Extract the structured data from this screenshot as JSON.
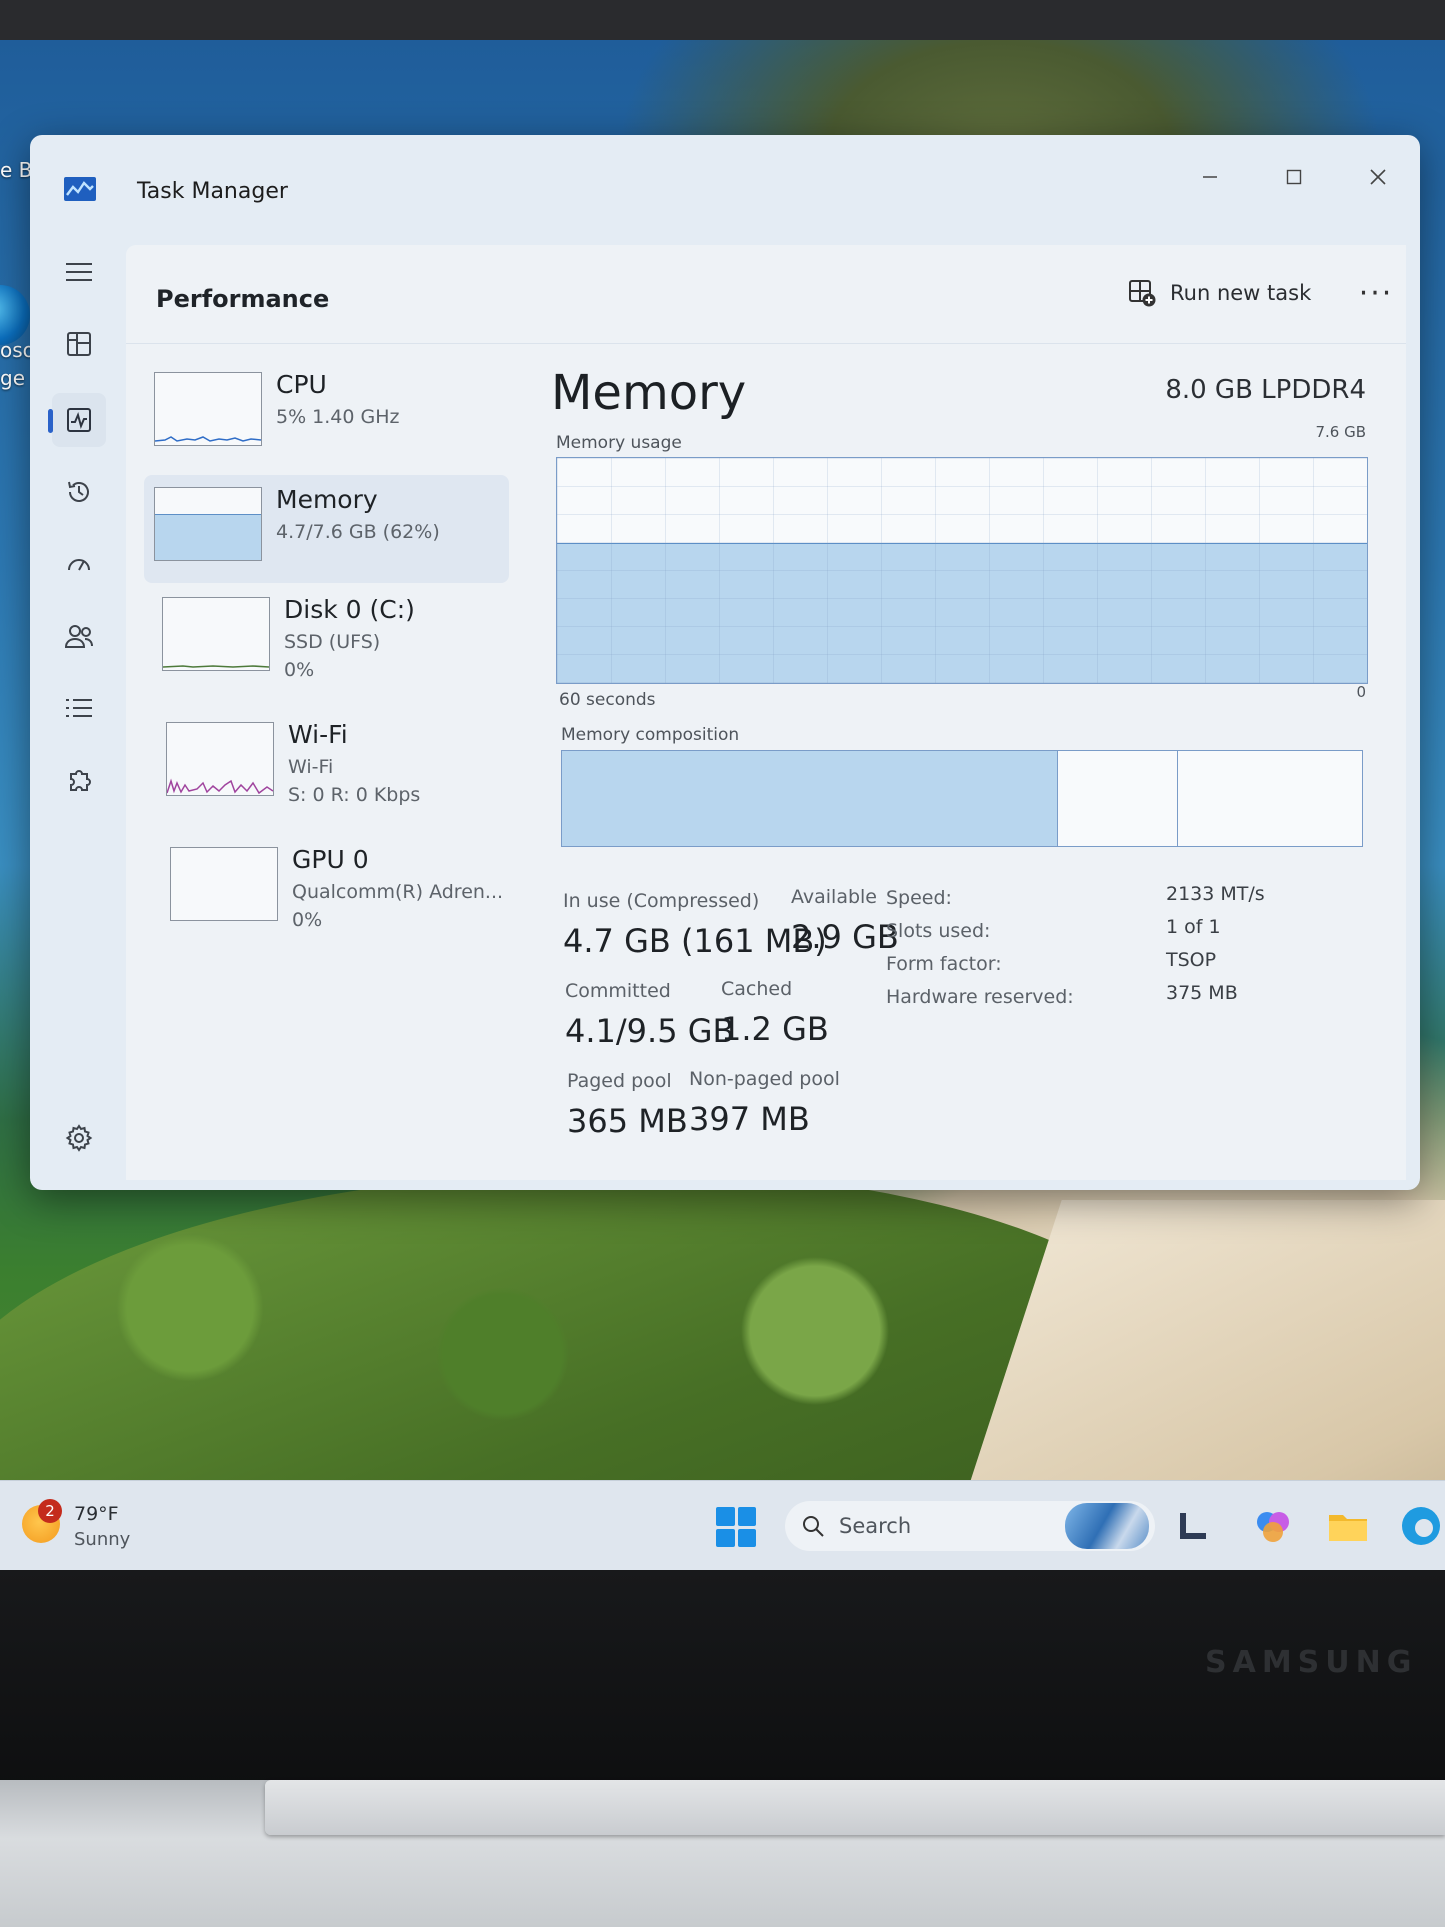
{
  "window": {
    "title": "Task Manager"
  },
  "header": {
    "title": "Performance",
    "run_new_task": "Run new task",
    "more": "···"
  },
  "perf_list": [
    {
      "name": "CPU",
      "sub": "5%  1.40 GHz",
      "sub2": ""
    },
    {
      "name": "Memory",
      "sub": "4.7/7.6 GB (62%)",
      "sub2": ""
    },
    {
      "name": "Disk 0 (C:)",
      "sub": "SSD (UFS)",
      "sub2": "0%"
    },
    {
      "name": "Wi-Fi",
      "sub": "Wi-Fi",
      "sub2": "S: 0  R: 0 Kbps"
    },
    {
      "name": "GPU 0",
      "sub": "Qualcomm(R) Adren...",
      "sub2": "0%"
    }
  ],
  "memory": {
    "title": "Memory",
    "spec": "8.0 GB LPDDR4",
    "usage_label": "Memory usage",
    "usage_max": "7.6 GB",
    "usage_fraction": 0.62,
    "time_left": "60 seconds",
    "time_right": "0",
    "composition_label": "Memory composition",
    "composition_fractions": [
      0.62,
      0.15,
      0.23
    ],
    "stats": {
      "in_use_label": "In use (Compressed)",
      "in_use_value": "4.7 GB (161 MB)",
      "available_label": "Available",
      "available_value": "2.9 GB",
      "committed_label": "Committed",
      "committed_value": "4.1/9.5 GB",
      "cached_label": "Cached",
      "cached_value": "1.2 GB",
      "paged_label": "Paged pool",
      "paged_value": "365 MB",
      "nonpaged_label": "Non-paged pool",
      "nonpaged_value": "397 MB"
    },
    "specs": [
      {
        "key": "Speed:",
        "value": "2133 MT/s"
      },
      {
        "key": "Slots used:",
        "value": "1 of 1"
      },
      {
        "key": "Form factor:",
        "value": "TSOP"
      },
      {
        "key": "Hardware reserved:",
        "value": "375 MB"
      }
    ]
  },
  "taskbar": {
    "weather_badge": "2",
    "weather_temp": "79°F",
    "weather_cond": "Sunny",
    "search_label": "Search"
  },
  "desktop": {
    "partial_labels": [
      "e B",
      "osof",
      "ge"
    ]
  },
  "laptop": {
    "brand": "SAMSUNG"
  }
}
